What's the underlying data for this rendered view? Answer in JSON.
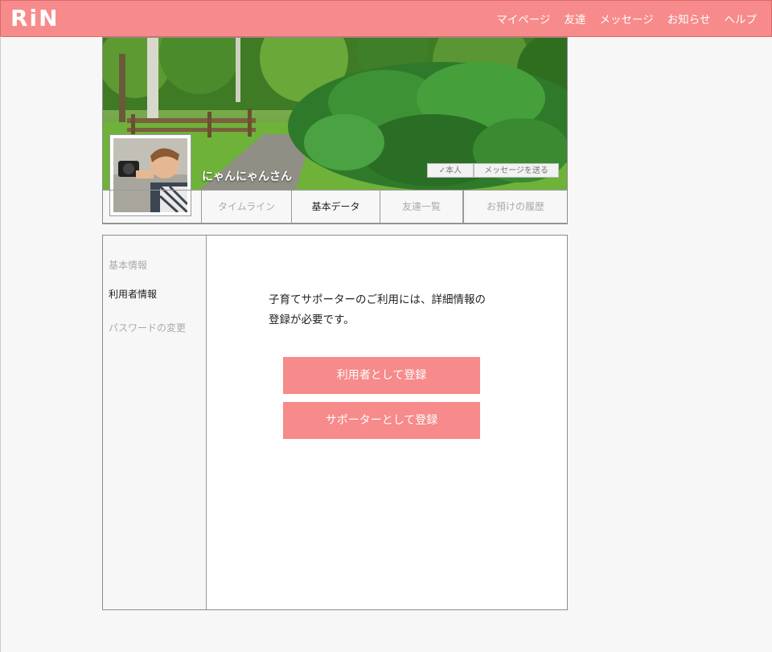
{
  "app": {
    "logo": "RiN",
    "accent_color": "#f78a8a"
  },
  "nav": [
    "マイページ",
    "友達",
    "メッセージ",
    "お知らせ",
    "ヘルプ"
  ],
  "profile": {
    "username": "にゃんにゃんさん",
    "self_badge": "✓本人",
    "send_message_button": "メッセージを送る",
    "tabs": [
      {
        "label": "タイムライン",
        "active": false
      },
      {
        "label": "基本データ",
        "active": true
      },
      {
        "label": "友達一覧",
        "active": false
      },
      {
        "label": "お預けの履歴",
        "active": false
      }
    ]
  },
  "sidebar": {
    "items": [
      {
        "label": "基本情報",
        "active": false
      },
      {
        "label": "利用者情報",
        "active": true
      },
      {
        "label": "パスワードの変更",
        "active": false
      }
    ]
  },
  "main": {
    "message_line1": "子育てサポーターのご利用には、詳細情報の",
    "message_line2": "登録が必要です。",
    "register_user_button": "利用者として登録",
    "register_supporter_button": "サポーターとして登録"
  }
}
